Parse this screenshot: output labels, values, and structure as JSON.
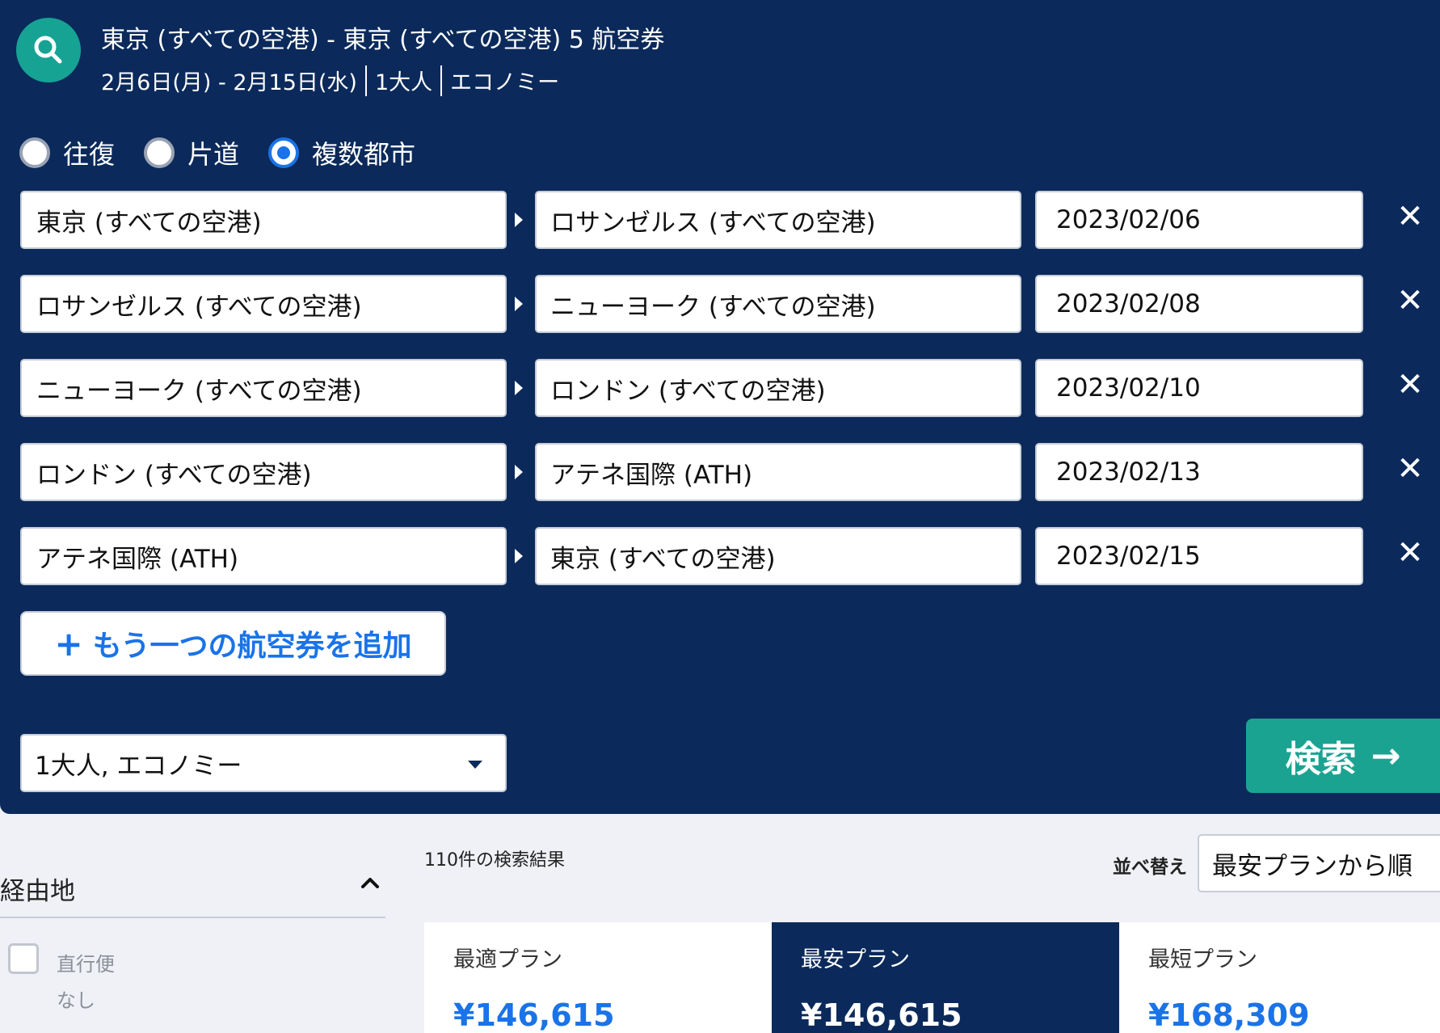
{
  "header": {
    "title": "東京 (すべての空港) - 東京 (すべての空港) 5 航空券",
    "dates": "2月6日(月) - 2月15日(水)",
    "travelers": "1大人",
    "cabin": "エコノミー"
  },
  "trip_types": [
    {
      "label": "往復",
      "selected": false
    },
    {
      "label": "片道",
      "selected": false
    },
    {
      "label": "複数都市",
      "selected": true
    }
  ],
  "legs": [
    {
      "from": "東京 (すべての空港)",
      "to": "ロサンゼルス (すべての空港)",
      "date": "2023/02/06"
    },
    {
      "from": "ロサンゼルス (すべての空港)",
      "to": "ニューヨーク (すべての空港)",
      "date": "2023/02/08"
    },
    {
      "from": "ニューヨーク (すべての空港)",
      "to": "ロンドン (すべての空港)",
      "date": "2023/02/10"
    },
    {
      "from": "ロンドン (すべての空港)",
      "to": "アテネ国際 (ATH)",
      "date": "2023/02/13"
    },
    {
      "from": "アテネ国際 (ATH)",
      "to": "東京 (すべての空港)",
      "date": "2023/02/15"
    }
  ],
  "add_flight": {
    "plus": "+",
    "label": "もう一つの航空券を追加"
  },
  "passenger_select": {
    "value": "1大人, エコノミー"
  },
  "search_button": {
    "label": "検索",
    "arrow": "→"
  },
  "filters": {
    "stops_title": "経由地",
    "direct_label": "直行便",
    "direct_sub": "なし"
  },
  "results": {
    "count_text": "110件の検索結果",
    "sort_label": "並べ替え",
    "sort_value": "最安プランから順"
  },
  "plan_tabs": [
    {
      "label": "最適プラン",
      "price": "¥146,615",
      "active": false
    },
    {
      "label": "最安プラン",
      "price": "¥146,615",
      "active": true
    },
    {
      "label": "最短プラン",
      "price": "¥168,309",
      "active": false
    }
  ],
  "colors": {
    "panel": "#0b2a5b",
    "accent": "#1a73e8",
    "search_green": "#1ba392"
  },
  "icons": {
    "search": "search-icon",
    "close": "close-icon",
    "caret": "caret-down-icon",
    "chevron": "chevron-up-icon",
    "arrow": "arrow-right-icon"
  }
}
